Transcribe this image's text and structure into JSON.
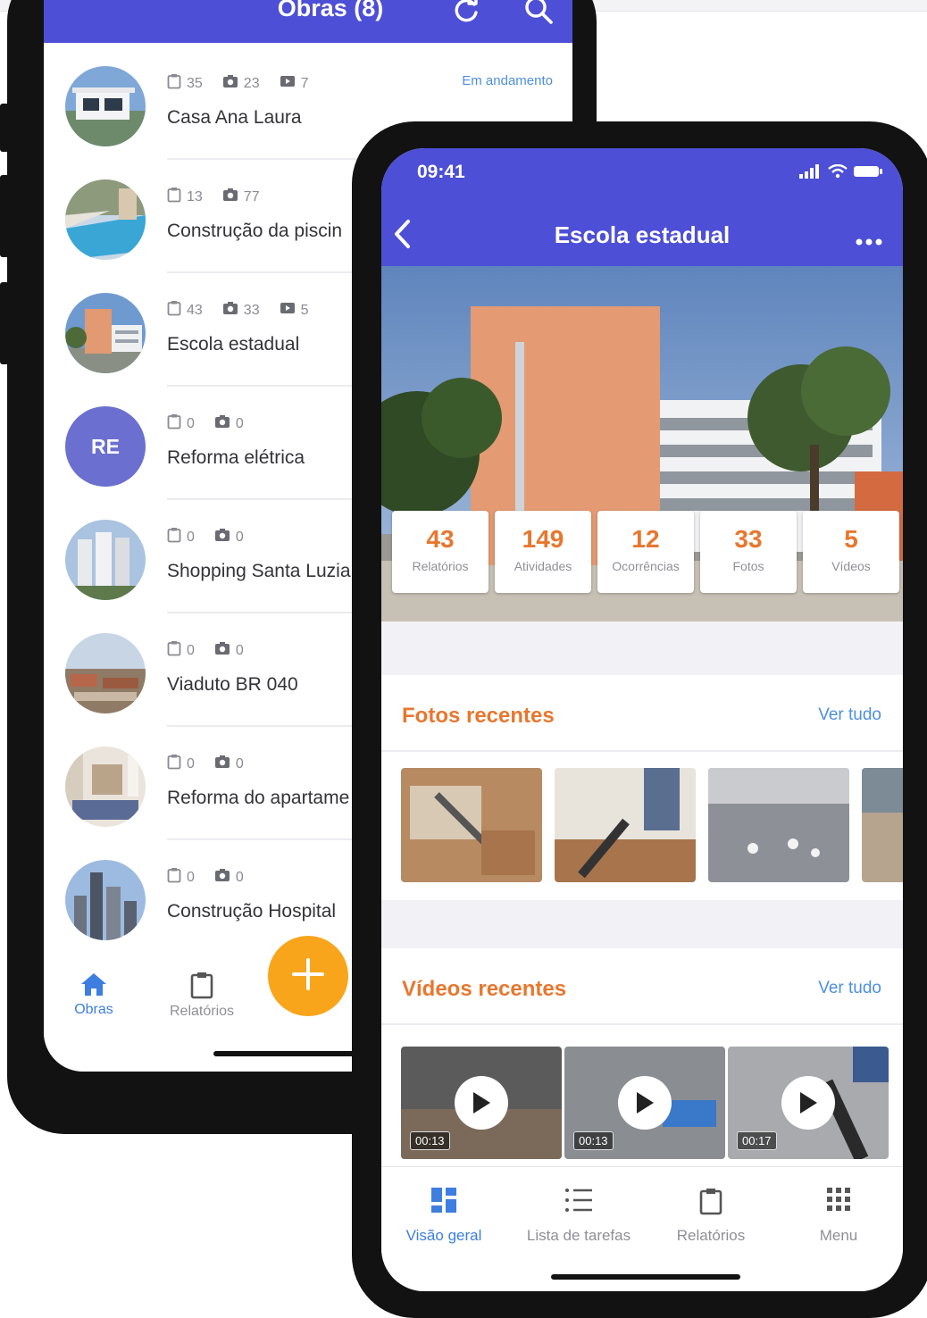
{
  "back_phone": {
    "header": {
      "title": "Obras (8)",
      "refresh_icon": "refresh-icon",
      "search_icon": "search-icon",
      "color": "#4d4fd6"
    },
    "obras": [
      {
        "name": "Casa Ana Laura",
        "reports": "35",
        "photos": "23",
        "videos": "7",
        "status": "Em andamento",
        "avatar": "house-photo"
      },
      {
        "name": "Construção da piscin",
        "reports": "13",
        "photos": "77",
        "videos": "",
        "status": "",
        "avatar": "pool-photo"
      },
      {
        "name": "Escola estadual",
        "reports": "43",
        "photos": "33",
        "videos": "5",
        "status": "",
        "avatar": "school-photo"
      },
      {
        "name": "Reforma elétrica",
        "reports": "0",
        "photos": "0",
        "videos": "",
        "status": "",
        "avatar_initials": "RE"
      },
      {
        "name": "Shopping Santa Luzia",
        "reports": "0",
        "photos": "0",
        "videos": "",
        "status": "",
        "avatar": "towers-photo"
      },
      {
        "name": "Viaduto BR 040",
        "reports": "0",
        "photos": "0",
        "videos": "",
        "status": "",
        "avatar": "city-photo"
      },
      {
        "name": "Reforma do apartame",
        "reports": "0",
        "photos": "0",
        "videos": "",
        "status": "",
        "avatar": "room-photo"
      },
      {
        "name": "Construção Hospital",
        "reports": "0",
        "photos": "0",
        "videos": "",
        "status": "",
        "avatar": "skyline-photo"
      }
    ],
    "tabbar": {
      "obras": "Obras",
      "relatorios": "Relatórios",
      "fab_icon": "plus-icon",
      "fab_color": "#f8a51b"
    }
  },
  "front_phone": {
    "status_bar": {
      "time": "09:41"
    },
    "header": {
      "title": "Escola estadual",
      "back_icon": "chevron-left-icon",
      "more_icon": "more-icon"
    },
    "kpis": [
      {
        "value": "43",
        "label": "Relatórios"
      },
      {
        "value": "149",
        "label": "Atividades"
      },
      {
        "value": "12",
        "label": "Ocorrências"
      },
      {
        "value": "33",
        "label": "Fotos"
      },
      {
        "value": "5",
        "label": "Vídeos"
      }
    ],
    "photos_section": {
      "title": "Fotos recentes",
      "link": "Ver tudo"
    },
    "videos_section": {
      "title": "Vídeos recentes",
      "link": "Ver tudo",
      "videos": [
        {
          "duration": "00:13"
        },
        {
          "duration": "00:13"
        },
        {
          "duration": "00:17"
        }
      ]
    },
    "tabbar": {
      "items": [
        {
          "label": "Visão geral",
          "icon": "dashboard-icon",
          "active": true
        },
        {
          "label": "Lista de tarefas",
          "icon": "list-icon",
          "active": false
        },
        {
          "label": "Relatórios",
          "icon": "clipboard-icon",
          "active": false
        },
        {
          "label": "Menu",
          "icon": "grid-icon",
          "active": false
        }
      ]
    }
  },
  "colors": {
    "accent": "#4d4fd6",
    "orange": "#e8772e",
    "link": "#4d8fe0"
  }
}
